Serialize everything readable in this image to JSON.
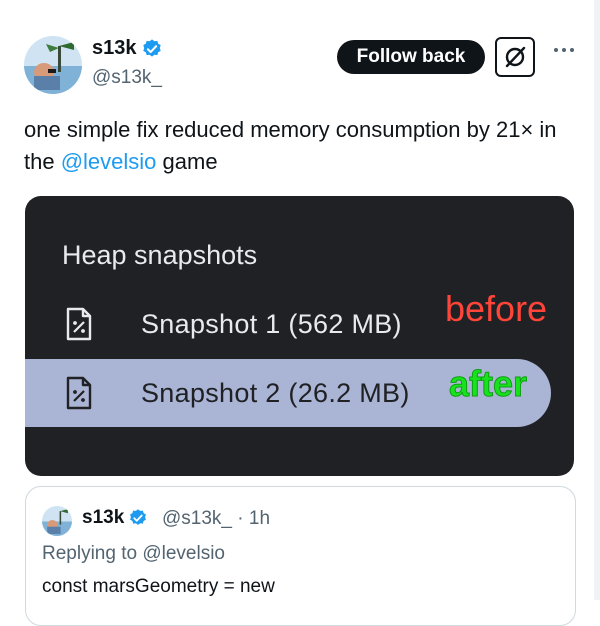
{
  "author": {
    "display_name": "s13k",
    "handle": "@s13k_"
  },
  "actions": {
    "follow_label": "Follow back",
    "grok_icon": "grok-icon",
    "more_icon": "more-icon"
  },
  "tweet": {
    "text_before": "one simple fix reduced memory consumption by 21× in the ",
    "mention": "@levelsio",
    "text_after": " game"
  },
  "media": {
    "title": "Heap snapshots",
    "snapshots": [
      {
        "label": "Snapshot 1 (562 MB)",
        "annotation": "before"
      },
      {
        "label": "Snapshot 2 (26.2 MB)",
        "annotation": "after"
      }
    ]
  },
  "quote": {
    "display_name": "s13k",
    "handle_time": "@s13k_ · 1h",
    "replying_prefix": "Replying to ",
    "replying_mention": "@levelsio",
    "text": "const marsGeometry = new"
  },
  "colors": {
    "verified": "#1d9bf0",
    "mention": "#1d9bf0",
    "before": "#ff453a",
    "after": "#17e21d",
    "selected_row": "#aab4d4"
  }
}
